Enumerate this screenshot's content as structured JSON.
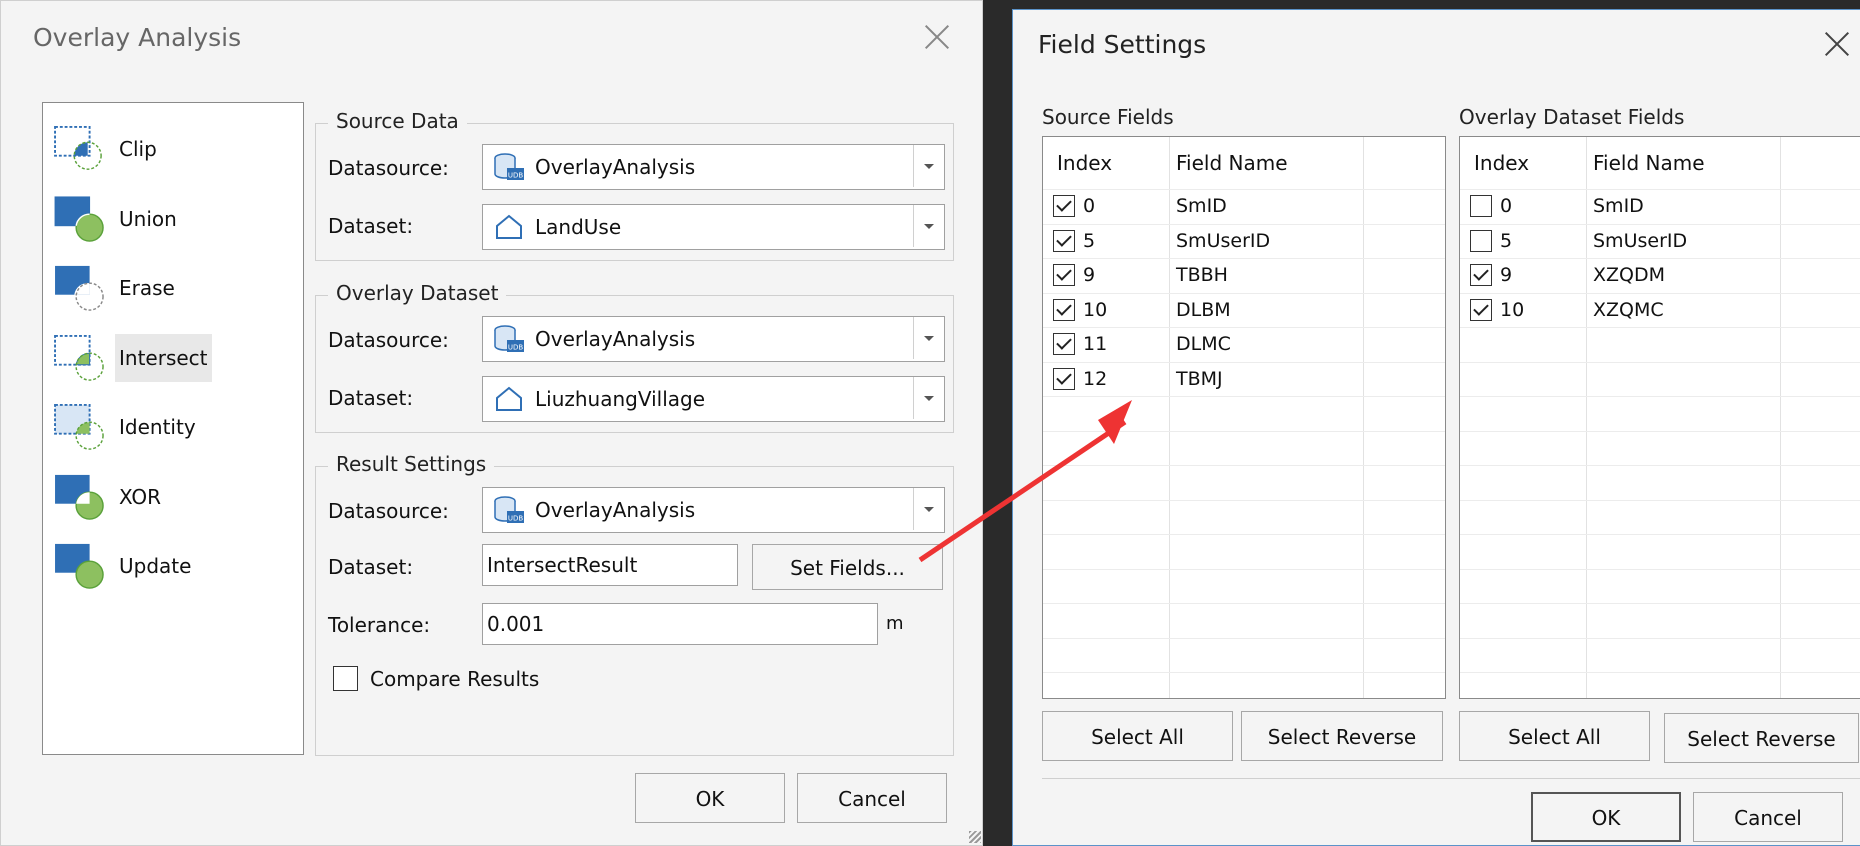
{
  "overlay_dialog": {
    "title": "Overlay Analysis",
    "tools": [
      {
        "label": "Clip",
        "icon": "clip-icon"
      },
      {
        "label": "Union",
        "icon": "union-icon"
      },
      {
        "label": "Erase",
        "icon": "erase-icon"
      },
      {
        "label": "Intersect",
        "icon": "intersect-icon",
        "selected": true
      },
      {
        "label": "Identity",
        "icon": "identity-icon"
      },
      {
        "label": "XOR",
        "icon": "xor-icon"
      },
      {
        "label": "Update",
        "icon": "update-icon"
      }
    ],
    "source_data": {
      "title": "Source Data",
      "datasource_label": "Datasource:",
      "datasource_value": "OverlayAnalysis",
      "dataset_label": "Dataset:",
      "dataset_value": "LandUse"
    },
    "overlay_dataset": {
      "title": "Overlay Dataset",
      "datasource_label": "Datasource:",
      "datasource_value": "OverlayAnalysis",
      "dataset_label": "Dataset:",
      "dataset_value": "LiuzhuangVillage"
    },
    "result_settings": {
      "title": "Result Settings",
      "datasource_label": "Datasource:",
      "datasource_value": "OverlayAnalysis",
      "dataset_label": "Dataset:",
      "dataset_value": "IntersectResult",
      "set_fields_label": "Set Fields...",
      "tolerance_label": "Tolerance:",
      "tolerance_value": "0.001",
      "tolerance_unit": "m",
      "compare_label": "Compare Results",
      "compare_checked": false
    },
    "ok_label": "OK",
    "cancel_label": "Cancel"
  },
  "field_dialog": {
    "title": "Field Settings",
    "source_fields": {
      "label": "Source Fields",
      "col_index": "Index",
      "col_name": "Field Name",
      "rows": [
        {
          "index": "0",
          "name": "SmID",
          "checked": true
        },
        {
          "index": "5",
          "name": "SmUserID",
          "checked": true
        },
        {
          "index": "9",
          "name": "TBBH",
          "checked": true
        },
        {
          "index": "10",
          "name": "DLBM",
          "checked": true
        },
        {
          "index": "11",
          "name": "DLMC",
          "checked": true
        },
        {
          "index": "12",
          "name": "TBMJ",
          "checked": true
        }
      ],
      "select_all_label": "Select All",
      "select_reverse_label": "Select Reverse"
    },
    "overlay_fields": {
      "label": "Overlay Dataset Fields",
      "col_index": "Index",
      "col_name": "Field Name",
      "rows": [
        {
          "index": "0",
          "name": "SmID",
          "checked": false
        },
        {
          "index": "5",
          "name": "SmUserID",
          "checked": false
        },
        {
          "index": "9",
          "name": "XZQDM",
          "checked": true
        },
        {
          "index": "10",
          "name": "XZQMC",
          "checked": true
        }
      ],
      "select_all_label": "Select All",
      "select_reverse_label": "Select Reverse"
    },
    "ok_label": "OK",
    "cancel_label": "Cancel"
  },
  "colors": {
    "dialog_bg": "#f4f4f4",
    "backdrop": "#2a2a2a",
    "active_border": "#5b93c9",
    "annotation_arrow": "#ee3333",
    "icon_blue": "#2f6fb5",
    "icon_green": "#8dc060"
  }
}
